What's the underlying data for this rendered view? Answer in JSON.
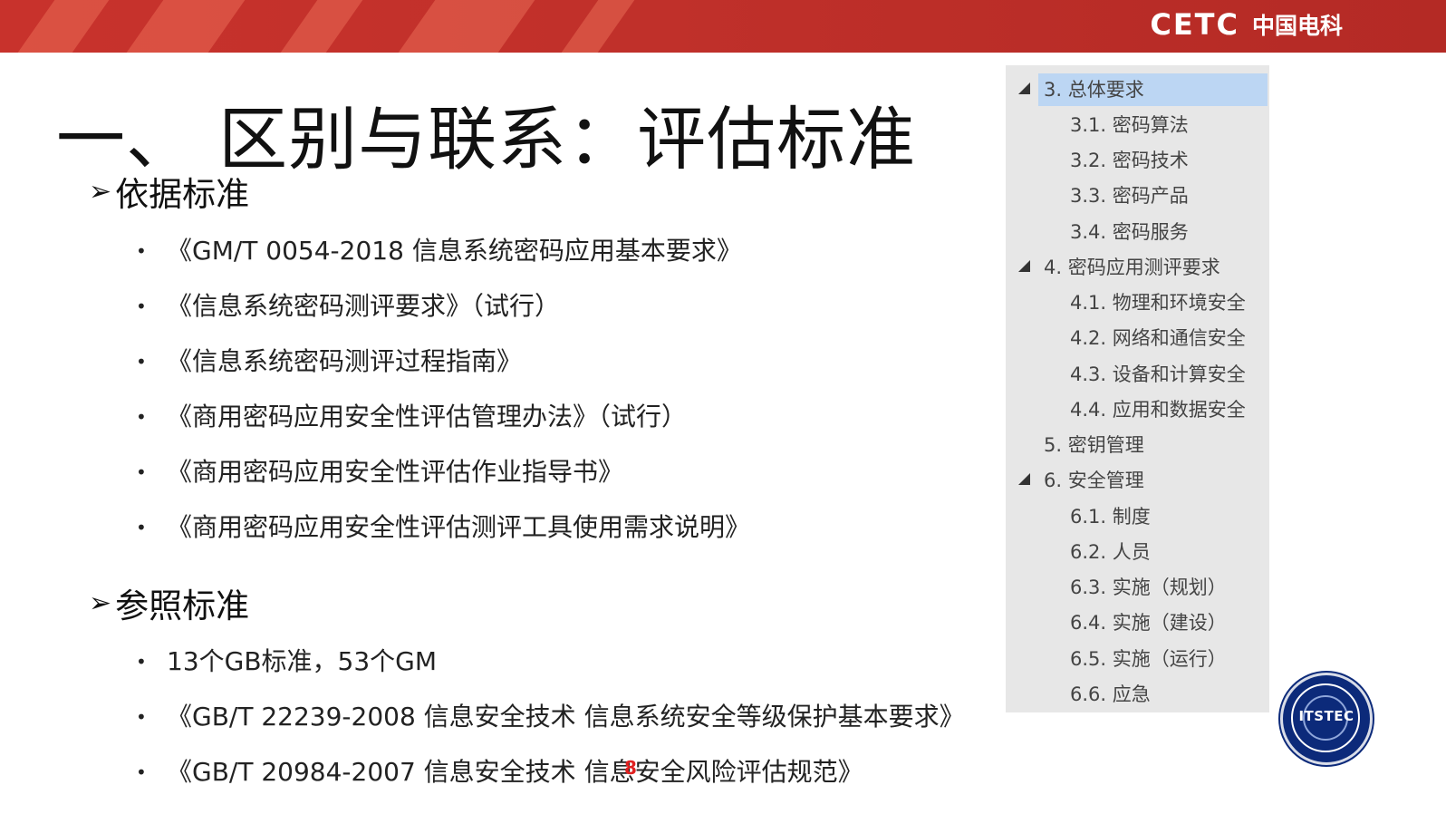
{
  "header": {
    "logo_en": "CETC",
    "logo_cn": "中国电科"
  },
  "title": "一、 区别与联系：评估标准",
  "section1": {
    "arrow": "➢",
    "heading": "依据标准"
  },
  "list1": [
    "《GM/T 0054-2018 信息系统密码应用基本要求》",
    "《信息系统密码测评要求》（试行）",
    "《信息系统密码测评过程指南》",
    "《商用密码应用安全性评估管理办法》（试行）",
    "《商用密码应用安全性评估作业指导书》",
    "《商用密码应用安全性评估测评工具使用需求说明》"
  ],
  "section2": {
    "arrow": "➢",
    "heading": "参照标准"
  },
  "list2": [
    "13个GB标准，53个GM",
    "《GB/T 22239-2008 信息安全技术 信息系统安全等级保护基本要求》",
    "《GB/T 20984-2007 信息安全技术 信息安全风险评估规范》"
  ],
  "bullet_char": "•",
  "toc": [
    "3. 总体要求",
    "3.1. 密码算法",
    "3.2. 密码技术",
    "3.3. 密码产品",
    "3.4. 密码服务",
    "4. 密码应用测评要求",
    "4.1. 物理和环境安全",
    "4.2. 网络和通信安全",
    "4.3. 设备和计算安全",
    "4.4. 应用和数据安全",
    "5. 密钥管理",
    "6. 安全管理",
    "6.1. 制度",
    "6.2. 人员",
    "6.3. 实施（规划）",
    "6.4. 实施（建设）",
    "6.5. 实施（运行）",
    "6.6. 应急"
  ],
  "page_number": "8",
  "badge_text": "ITSTEC",
  "colors": {
    "banner": "#c0302a",
    "selection": "#bcd6f3",
    "tree_bg": "#e7e7e7",
    "page_number": "#e02020"
  }
}
